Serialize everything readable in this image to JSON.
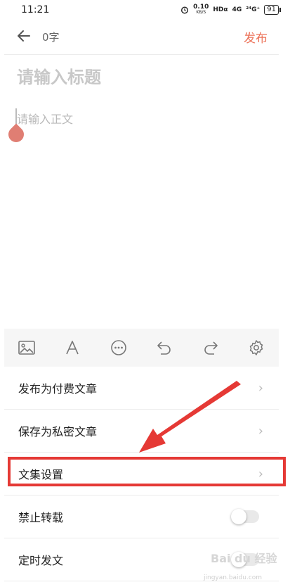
{
  "status": {
    "time": "11:21",
    "speed_value": "0.10",
    "speed_unit": "KB/S",
    "hd": "HDα",
    "signal1": "4G",
    "signal2": "²⁴G⁺",
    "battery": "91"
  },
  "header": {
    "word_count": "0字",
    "publish_label": "发布"
  },
  "editor": {
    "title_placeholder": "请输入标题",
    "body_placeholder": "请输入正文"
  },
  "toolbar": {
    "icons": [
      "image-icon",
      "font-icon",
      "more-icon",
      "undo-icon",
      "redo-icon",
      "settings-icon"
    ]
  },
  "menu": {
    "items": [
      {
        "label": "发布为付费文章",
        "control": "chevron"
      },
      {
        "label": "保存为私密文章",
        "control": "chevron"
      },
      {
        "label": "文集设置",
        "control": "chevron"
      },
      {
        "label": "禁止转载",
        "control": "toggle",
        "on": false
      },
      {
        "label": "定时发文",
        "control": "toggle",
        "on": false
      }
    ]
  },
  "colors": {
    "accent": "#ec7259",
    "highlight": "#e53935"
  },
  "watermark": {
    "main": "Bai du 经验",
    "sub": "jingyan.baidu.com"
  }
}
